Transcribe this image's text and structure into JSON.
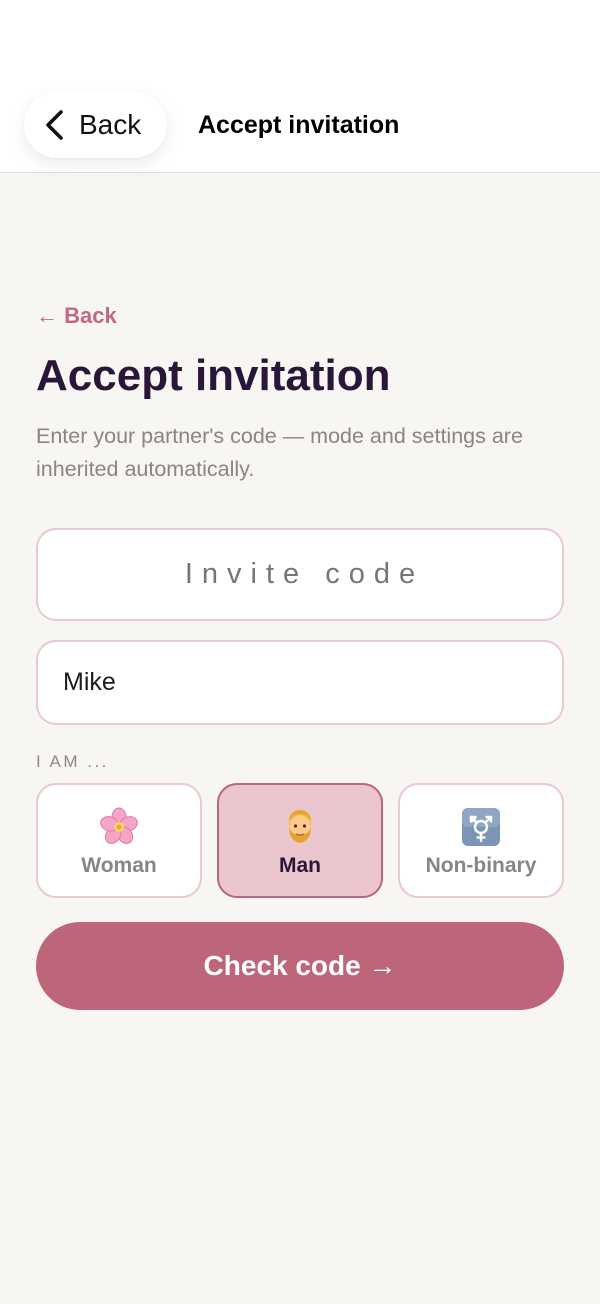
{
  "nav": {
    "back_label": "Back",
    "title": "Accept invitation"
  },
  "form": {
    "back_link": "← Back",
    "title": "Accept invitation",
    "subtitle": "Enter your partner's code — mode and settings are inherited automatically.",
    "invite_code": {
      "placeholder": "Invite code",
      "value": ""
    },
    "name": {
      "placeholder": "",
      "value": "Mike"
    },
    "iam_label": "I AM ...",
    "gender_options": [
      {
        "label": "Woman",
        "icon": "cherry-blossom-icon",
        "selected": false
      },
      {
        "label": "Man",
        "icon": "man-blond-beard-icon",
        "selected": true
      },
      {
        "label": "Non-binary",
        "icon": "transgender-symbol-icon",
        "selected": false
      }
    ],
    "submit_label": "Check code →"
  },
  "colors": {
    "accent": "#bd6679",
    "accent_light": "#ecc6cf",
    "field_border": "#ecc7d0",
    "title_text": "#2a1638",
    "background": "#f8f6f3"
  }
}
